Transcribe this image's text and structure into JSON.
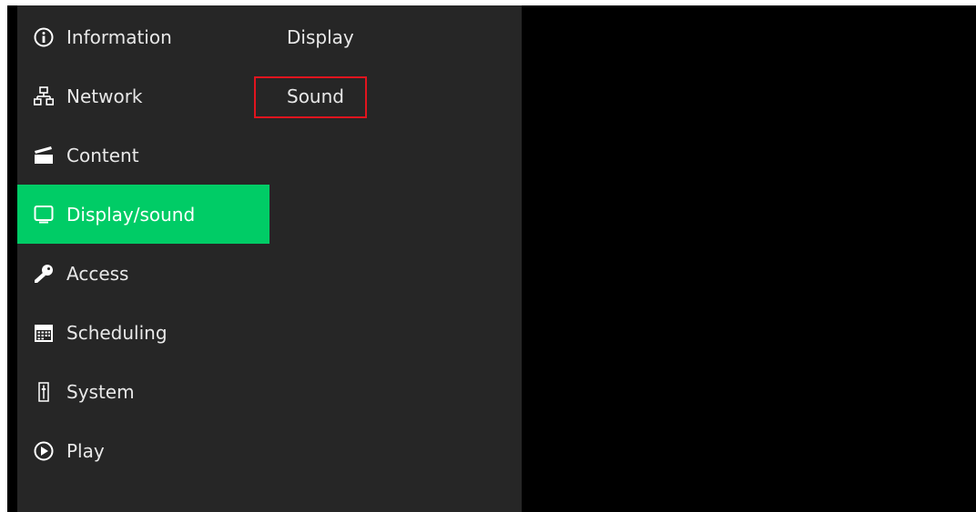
{
  "sidebar": {
    "items": [
      {
        "label": "Information",
        "icon": "info-icon"
      },
      {
        "label": "Network",
        "icon": "network-icon"
      },
      {
        "label": "Content",
        "icon": "clapperboard-icon"
      },
      {
        "label": "Display/sound",
        "icon": "monitor-icon",
        "active": true
      },
      {
        "label": "Access",
        "icon": "key-icon"
      },
      {
        "label": "Scheduling",
        "icon": "calendar-icon"
      },
      {
        "label": "System",
        "icon": "system-icon"
      },
      {
        "label": "Play",
        "icon": "play-icon"
      }
    ]
  },
  "submenu": {
    "items": [
      {
        "label": "Display"
      },
      {
        "label": "Sound",
        "highlighted": true
      }
    ]
  },
  "colors": {
    "panel": "#262626",
    "background": "#000000",
    "active": "#00cc66",
    "highlight_border": "#e0141e",
    "text": "#e8e8e8"
  }
}
